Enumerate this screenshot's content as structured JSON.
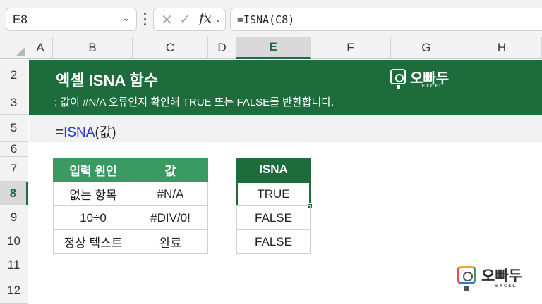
{
  "formula_bar": {
    "name_box": "E8",
    "formula": "=ISNA(C8)",
    "icons": [
      "cancel-icon",
      "enter-check-icon",
      "insert-function-icon"
    ]
  },
  "columns": [
    "A",
    "B",
    "C",
    "D",
    "E",
    "F",
    "G",
    "H"
  ],
  "selected_column": "E",
  "rows": [
    "2",
    "3",
    "5",
    "6",
    "7",
    "8",
    "9",
    "10",
    "11",
    "12"
  ],
  "selected_row": "8",
  "banner": {
    "title": "엑셀 ISNA 함수",
    "subtitle": ": 값이 #N/A 오류인지 확인해 TRUE 또는 FALSE를 반환합니다.",
    "logo_text": "오빠두",
    "logo_sub": "EXCEL"
  },
  "syntax": {
    "prefix": "=",
    "function": "ISNA",
    "args": "(값)"
  },
  "input_table": {
    "headers": [
      "입력 원인",
      "값"
    ],
    "rows": [
      [
        "없는 항목",
        "#N/A"
      ],
      [
        "10÷0",
        "#DIV/0!"
      ],
      [
        "정상 텍스트",
        "완료"
      ]
    ]
  },
  "result_table": {
    "header": "ISNA",
    "values": [
      "TRUE",
      "FALSE",
      "FALSE"
    ]
  },
  "footer_logo": {
    "text": "오빠두",
    "sub": "EXCEL"
  },
  "colors": {
    "excel_green": "#1e6b3c",
    "header_green": "#3a9a62",
    "function_blue": "#2137c7"
  }
}
